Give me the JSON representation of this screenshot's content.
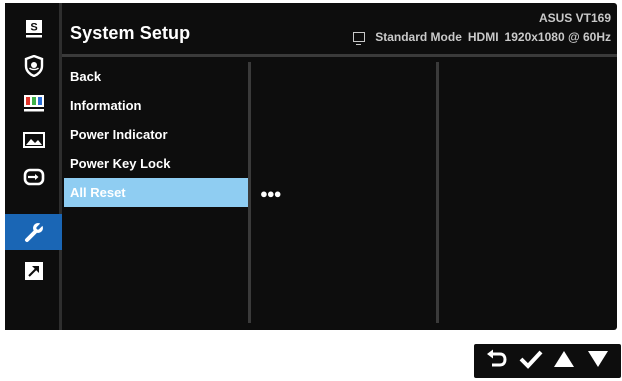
{
  "header": {
    "title": "System Setup",
    "model": "ASUS VT169",
    "mode": "Standard Mode",
    "input": "HDMI",
    "resolution": "1920x1080 @ 60Hz"
  },
  "rail": {
    "items": [
      {
        "icon": "splendid-icon",
        "active": false
      },
      {
        "icon": "eye-care-icon",
        "active": false
      },
      {
        "icon": "color-icon",
        "active": false
      },
      {
        "icon": "image-icon",
        "active": false
      },
      {
        "icon": "input-select-icon",
        "active": false
      },
      {
        "icon": "system-setup-icon",
        "active": true
      },
      {
        "icon": "shortcut-icon",
        "active": false
      }
    ]
  },
  "menu": {
    "items": [
      {
        "label": "Back"
      },
      {
        "label": "Information"
      },
      {
        "label": "Power Indicator"
      },
      {
        "label": "Power Key Lock"
      },
      {
        "label": "All Reset"
      }
    ],
    "selected_index": 4,
    "submenu_indicator": "●●●"
  },
  "keys": [
    {
      "icon": "back-arrow-icon"
    },
    {
      "icon": "check-icon"
    },
    {
      "icon": "up-triangle-icon"
    },
    {
      "icon": "down-triangle-icon"
    }
  ],
  "colors": {
    "active_rail": "#1a66b5",
    "selected_item": "#8fcdf2",
    "background": "#0d0d0d",
    "text": "#ffffff"
  }
}
